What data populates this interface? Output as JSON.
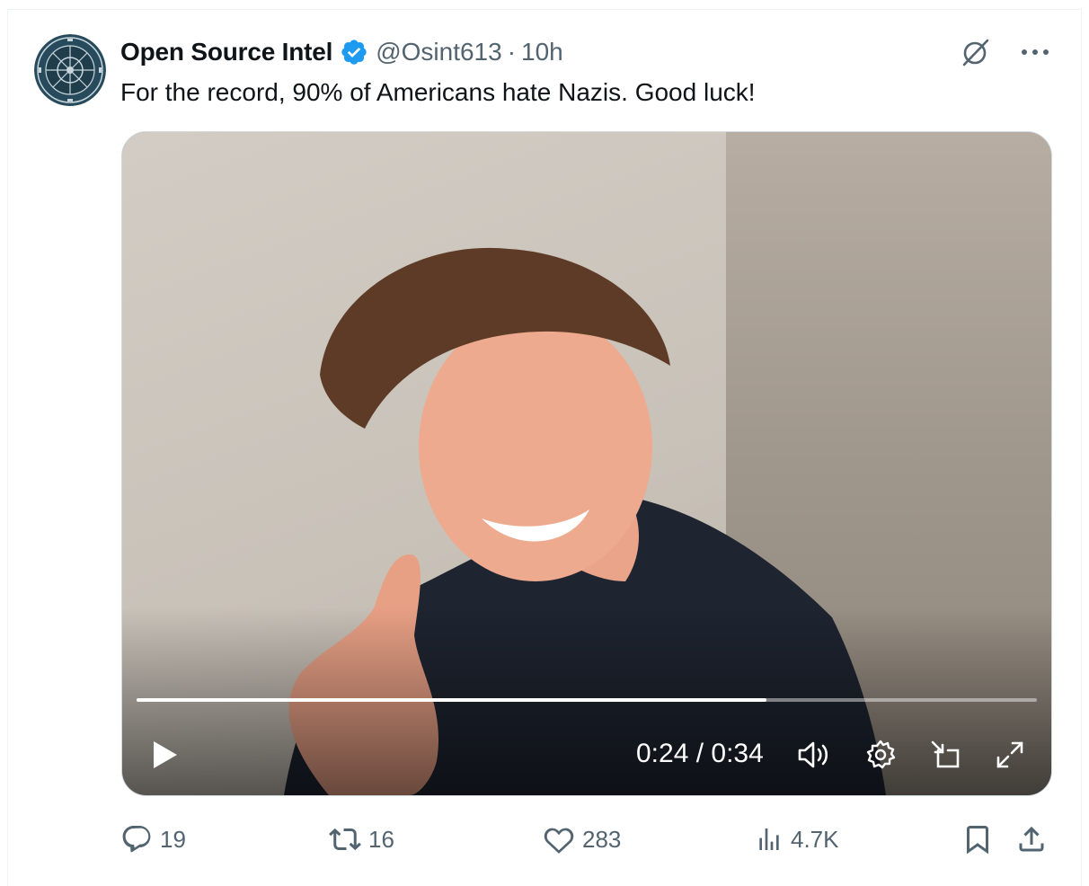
{
  "tweet": {
    "author_name": "Open Source Intel",
    "handle": "@Osint613",
    "separator": "·",
    "time": "10h",
    "text": "For the record, 90% of Americans hate Nazis. Good luck!",
    "verified_color": "#1d9bf0"
  },
  "header_icons": [
    "grok-icon",
    "more-icon"
  ],
  "video": {
    "current_time": "0:24",
    "duration": "0:34",
    "time_display": "0:24 / 0:34",
    "progress_fraction": 0.7,
    "controls": [
      "play-icon",
      "volume-icon",
      "settings-icon",
      "pip-icon",
      "fullscreen-icon"
    ]
  },
  "actions": {
    "replies": "19",
    "reposts": "16",
    "likes": "283",
    "views": "4.7K"
  },
  "colors": {
    "text": "#0f1419",
    "secondary": "#536471",
    "accent": "#1d9bf0"
  }
}
